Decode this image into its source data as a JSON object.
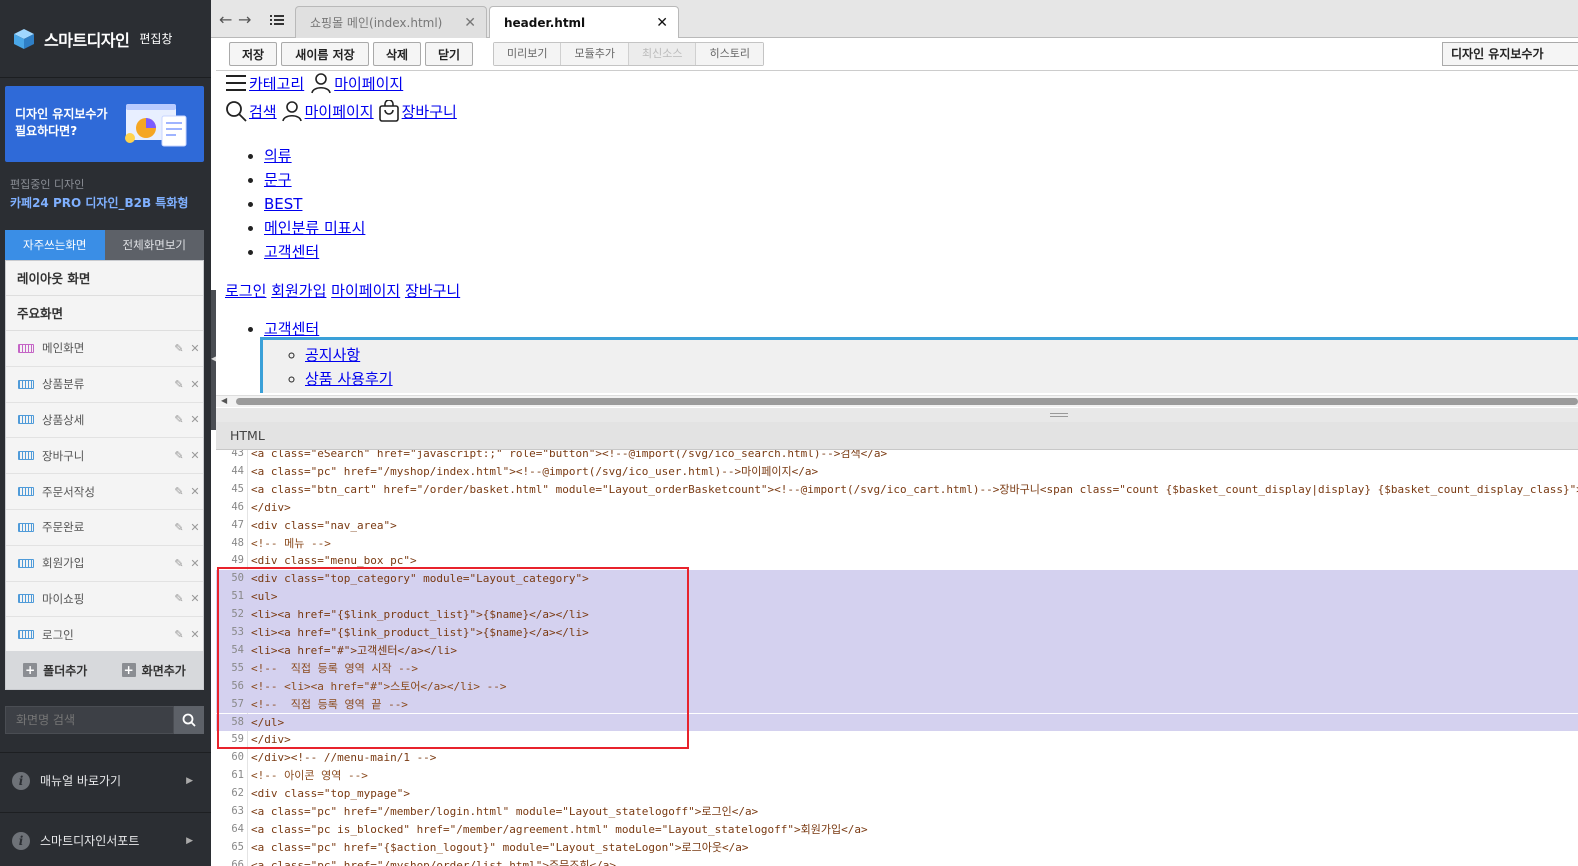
{
  "sidebar": {
    "brand": "스마트디자인",
    "subtitle": "편집창",
    "banner_text": "디자인 유지보수가\n필요하다면?",
    "editing_label": "편집중인 디자인",
    "editing_name": "카페24 PRO 디자인_B2B 특화형",
    "tabs": [
      "자주쓰는화면",
      "전체화면보기"
    ],
    "sections": {
      "layout": "레이아웃 화면",
      "main": "주요화면"
    },
    "items": [
      {
        "label": "메인화면"
      },
      {
        "label": "상품분류"
      },
      {
        "label": "상품상세"
      },
      {
        "label": "장바구니"
      },
      {
        "label": "주문서작성"
      },
      {
        "label": "주문완료"
      },
      {
        "label": "회원가입"
      },
      {
        "label": "마이쇼핑"
      },
      {
        "label": "로그인"
      }
    ],
    "footer": {
      "add_folder": "폴더추가",
      "add_screen": "화면추가"
    },
    "search_placeholder": "화면명 검색",
    "links": {
      "manual": "매뉴얼 바로가기",
      "support": "스마트디자인서포트"
    }
  },
  "tabs": [
    {
      "label": "쇼핑몰 메인(index.html)",
      "active": false
    },
    {
      "label": "header.html",
      "active": true
    }
  ],
  "toolbar": {
    "buttons": [
      "저장",
      "새이름 저장",
      "삭제",
      "닫기"
    ],
    "view_buttons": [
      "미리보기",
      "모듈추가",
      "최신소스",
      "히스토리"
    ],
    "maintenance": "디자인 유지보수가"
  },
  "preview": {
    "row1": {
      "category": "카테고리",
      "mypage": "마이페이지"
    },
    "row2": {
      "search": "검색",
      "mypage": "마이페이지",
      "cart": "장바구니"
    },
    "categories": [
      "의류",
      "문구",
      "BEST",
      "메인분류 미표시",
      "고객센터"
    ],
    "account_links": [
      "로그인",
      "회원가입",
      "마이페이지",
      "장바구니"
    ],
    "cs_title": "고객센터",
    "cs_items": [
      "공지사항",
      "상품 사용후기"
    ]
  },
  "code": {
    "panel_title": "HTML",
    "lines": [
      {
        "no": "43",
        "text": "<a class=\"eSearch\" href=\"javascript:;\" role=\"button\"><!--@import(/svg/ico_search.html)-->검색</a>",
        "hl": false
      },
      {
        "no": "44",
        "text": "<a class=\"pc\" href=\"/myshop/index.html\"><!--@import(/svg/ico_user.html)-->마이페이지</a>",
        "hl": false
      },
      {
        "no": "45",
        "text": "<a class=\"btn_cart\" href=\"/order/basket.html\" module=\"Layout_orderBasketcount\"><!--@import(/svg/ico_cart.html)-->장바구니<span class=\"count {$basket_count_display|display} {$basket_count_display_class}\"><span",
        "hl": false
      },
      {
        "no": "46",
        "text": "</div>",
        "hl": false
      },
      {
        "no": "47",
        "text": "<div class=\"nav_area\">",
        "hl": false
      },
      {
        "no": "48",
        "text": "<!-- 메뉴 -->",
        "hl": false
      },
      {
        "no": "49",
        "text": "<div class=\"menu_box pc\">",
        "hl": false
      },
      {
        "no": "50",
        "text": "<div class=\"top_category\" module=\"Layout_category\">",
        "hl": true
      },
      {
        "no": "51",
        "text": "<ul>",
        "hl": true
      },
      {
        "no": "52",
        "text": "<li><a href=\"{$link_product_list}\">{$name}</a></li>",
        "hl": true
      },
      {
        "no": "53",
        "text": "<li><a href=\"{$link_product_list}\">{$name}</a></li>",
        "hl": true
      },
      {
        "no": "54",
        "text": "<li><a href=\"#\">고객센터</a></li>",
        "hl": true
      },
      {
        "no": "55",
        "text": "<!--  직접 등록 영역 시작 -->",
        "hl": true
      },
      {
        "no": "56",
        "text": "<!-- <li><a href=\"#\">스토어</a></li> -->",
        "hl": true
      },
      {
        "no": "57",
        "text": "<!--  직접 등록 영역 끝 -->",
        "hl": true
      },
      {
        "no": "58",
        "text": "</ul>",
        "hl": true
      },
      {
        "no": "59",
        "text": "</div>",
        "hl": false
      },
      {
        "no": "60",
        "text": "</div><!-- //menu-main/1 -->",
        "hl": false
      },
      {
        "no": "61",
        "text": "<!-- 아이콘 영역 -->",
        "hl": false
      },
      {
        "no": "62",
        "text": "<div class=\"top_mypage\">",
        "hl": false
      },
      {
        "no": "63",
        "text": "<a class=\"pc\" href=\"/member/login.html\" module=\"Layout_statelogoff\">로그인</a>",
        "hl": false
      },
      {
        "no": "64",
        "text": "<a class=\"pc is_blocked\" href=\"/member/agreement.html\" module=\"Layout_statelogoff\">회원가입</a>",
        "hl": false
      },
      {
        "no": "65",
        "text": "<a class=\"pc\" href=\"{$action_logout}\" module=\"Layout_stateLogon\">로그아웃</a>",
        "hl": false
      },
      {
        "no": "66",
        "text": "<a class=\"pc\" href=\"/myshop/order/list.html\">주문조회</a>",
        "hl": false
      }
    ]
  },
  "colors": {
    "sidebar_bg": "#2b2e33",
    "accent": "#3a8ee6",
    "highlight": "#d4d1ef",
    "selection_box": "#e8232c"
  }
}
